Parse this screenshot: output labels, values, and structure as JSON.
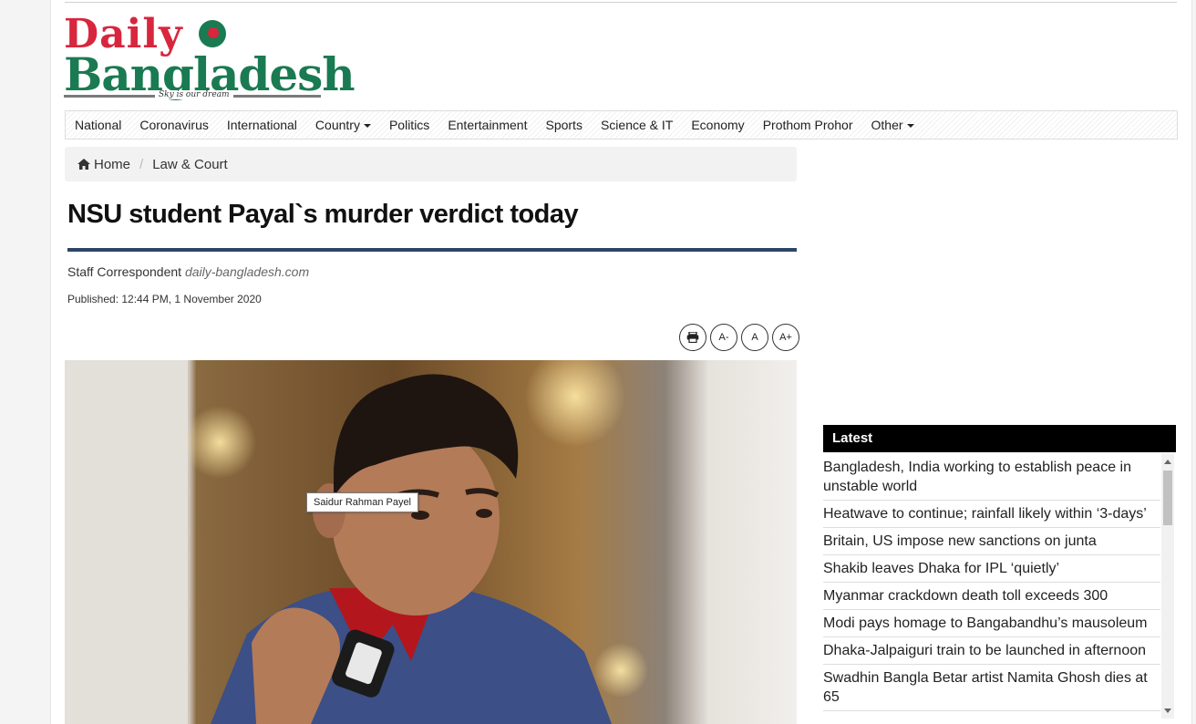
{
  "logo": {
    "word1": "Daily",
    "word2": "Bangladesh",
    "tagline": "Sky is our dream"
  },
  "nav": {
    "items": [
      {
        "label": "National"
      },
      {
        "label": "Coronavirus"
      },
      {
        "label": "International"
      },
      {
        "label": "Country",
        "dropdown": true
      },
      {
        "label": "Politics"
      },
      {
        "label": "Entertainment"
      },
      {
        "label": "Sports"
      },
      {
        "label": "Science & IT"
      },
      {
        "label": "Economy"
      },
      {
        "label": "Prothom Prohor"
      },
      {
        "label": "Other",
        "dropdown": true
      }
    ]
  },
  "breadcrumb": {
    "home": "Home",
    "separator": "/",
    "current": "Law & Court"
  },
  "article": {
    "headline": "NSU student Payal`s murder verdict today",
    "author": "Staff Correspondent",
    "source": "daily-bangladesh.com",
    "published": "Published: 12:44 PM, 1 November 2020",
    "font_tools": {
      "decrease": "A-",
      "normal": "A",
      "increase": "A+"
    },
    "image_tooltip": "Saidur Rahman Payel"
  },
  "latest": {
    "title": "Latest",
    "items": [
      "Bangladesh, India working to establish peace in unstable world",
      "Heatwave to continue; rainfall likely within ‘3-days’",
      "Britain, US impose new sanctions on junta",
      "Shakib leaves Dhaka for IPL ‘quietly’",
      "Myanmar crackdown death toll exceeds 300",
      "Modi pays homage to Bangabandhu’s mausoleum",
      "Dhaka-Jalpaiguri train to be launched in afternoon",
      "Swadhin Bangla Betar artist Namita Ghosh dies at 65"
    ]
  },
  "colors": {
    "brand_red": "#d7263d",
    "brand_green": "#1a7a52",
    "headline_rule": "#2c4565",
    "latest_header_bg": "#000000"
  },
  "icons": {
    "home": "home-icon",
    "print": "print-icon",
    "flag": "flag-icon"
  }
}
